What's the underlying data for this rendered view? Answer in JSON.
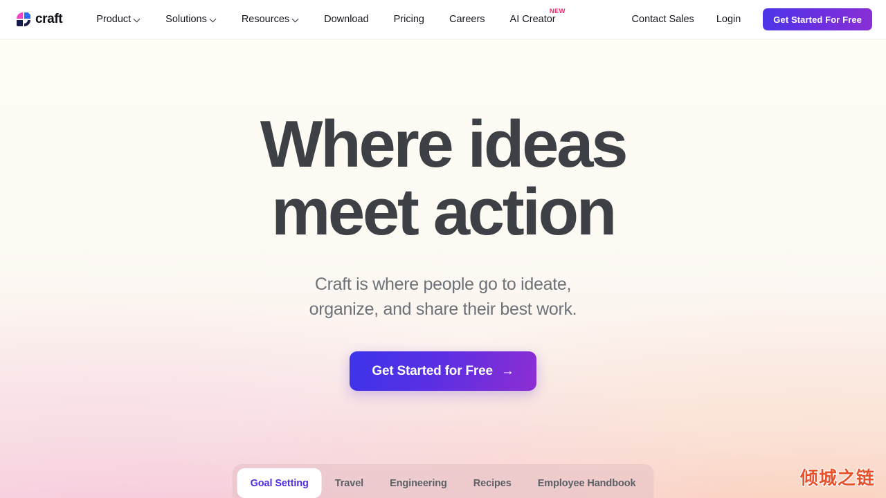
{
  "brand": {
    "name": "craft",
    "logo_icon": "craft-logo-icon",
    "colors": {
      "logo_pink": "#ef45c8",
      "logo_blue": "#2b6bf5",
      "logo_navy": "#151a4a"
    }
  },
  "navbar": {
    "links": [
      {
        "label": "Product",
        "has_dropdown": true
      },
      {
        "label": "Solutions",
        "has_dropdown": true
      },
      {
        "label": "Resources",
        "has_dropdown": true
      },
      {
        "label": "Download",
        "has_dropdown": false
      },
      {
        "label": "Pricing",
        "has_dropdown": false
      },
      {
        "label": "Careers",
        "has_dropdown": false
      },
      {
        "label": "AI Creator",
        "has_dropdown": false,
        "badge": "NEW"
      }
    ],
    "contact_sales_label": "Contact Sales",
    "login_label": "Login",
    "cta_label": "Get Started For Free",
    "badge_color": "#f5276a",
    "cta_gradient_from": "#4b36e8",
    "cta_gradient_to": "#8a2fd4"
  },
  "hero": {
    "title_line1": "Where ideas",
    "title_line2": "meet action",
    "subtitle_line1": "Craft is where people go to ideate,",
    "subtitle_line2": "organize, and share their best work.",
    "cta_label": "Get Started for Free",
    "cta_arrow": "→",
    "title_color": "#3d4045",
    "subtitle_color": "#6d7178",
    "cta_gradient_from": "#3b34ea",
    "cta_gradient_to": "#8d2ed2"
  },
  "tabbar": {
    "active_index": 0,
    "active_text_color": "#4f2ae8",
    "tabs": [
      {
        "label": "Goal Setting"
      },
      {
        "label": "Travel"
      },
      {
        "label": "Engineering"
      },
      {
        "label": "Recipes"
      },
      {
        "label": "Employee Handbook"
      }
    ]
  },
  "watermark": {
    "text": "倾城之链",
    "color": "#e8522b"
  }
}
